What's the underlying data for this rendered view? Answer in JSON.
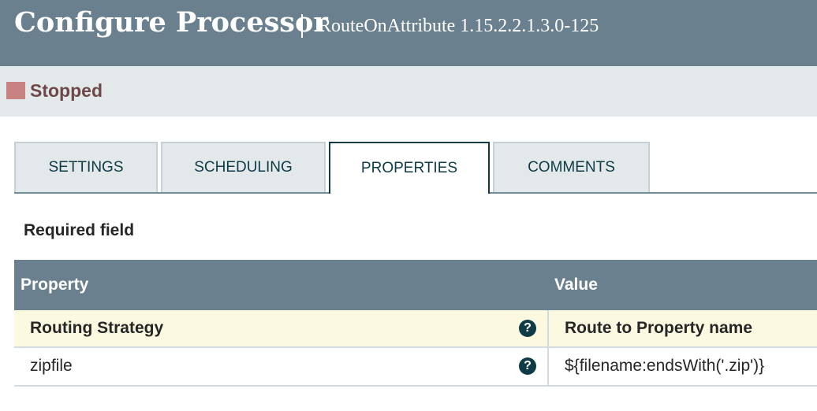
{
  "header": {
    "title": "Configure Processor",
    "subtitle": "RouteOnAttribute 1.15.2.2.1.3.0-125"
  },
  "status": {
    "label": "Stopped",
    "color": "#c98282"
  },
  "tabs": [
    {
      "label": "SETTINGS",
      "active": false
    },
    {
      "label": "SCHEDULING",
      "active": false
    },
    {
      "label": "PROPERTIES",
      "active": true
    },
    {
      "label": "COMMENTS",
      "active": false
    }
  ],
  "required_label": "Required field",
  "table": {
    "columns": [
      "Property",
      "Value"
    ],
    "rows": [
      {
        "property": "Routing Strategy",
        "help_icon": "?",
        "value": "Route to Property name",
        "required": true
      },
      {
        "property": "zipfile",
        "help_icon": "?",
        "value": "${filename:endsWith('.zip')}",
        "required": false
      }
    ]
  },
  "colors": {
    "header_bg": "#6a808f",
    "status_bg": "#e3e8eb",
    "required_row_bg": "#fcf9e1",
    "accent": "#0e3b45"
  }
}
